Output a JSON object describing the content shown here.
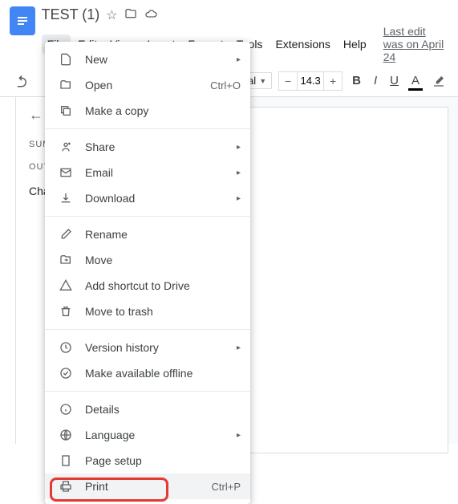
{
  "header": {
    "title": "TEST (1)",
    "edit_info": "Last edit was on April 24"
  },
  "menubar": {
    "file": "File",
    "edit": "Edit",
    "view": "View",
    "insert": "Insert",
    "format": "Format",
    "tools": "Tools",
    "extensions": "Extensions",
    "help": "Help"
  },
  "toolbar": {
    "font_size": "14.3"
  },
  "sidebar": {
    "summary": "SUMMARY",
    "outline": "OUTLINE",
    "item": "Cha"
  },
  "menu": {
    "new": "New",
    "open": "Open",
    "open_sc": "Ctrl+O",
    "copy": "Make a copy",
    "share": "Share",
    "email": "Email",
    "download": "Download",
    "rename": "Rename",
    "move": "Move",
    "shortcut": "Add shortcut to Drive",
    "trash": "Move to trash",
    "version": "Version history",
    "offline": "Make available offline",
    "details": "Details",
    "language": "Language",
    "pagesetup": "Page setup",
    "print": "Print",
    "print_sc": "Ctrl+P"
  }
}
